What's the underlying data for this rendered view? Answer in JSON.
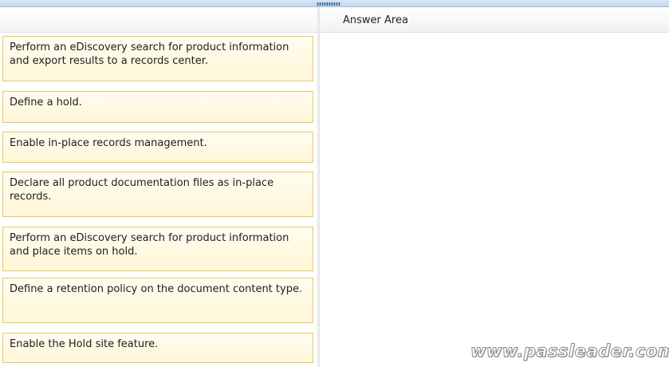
{
  "answer_area": {
    "title": "Answer Area"
  },
  "items": [
    "Perform an eDiscovery search for product information and export results to a records center.",
    "Define a hold.",
    "Enable in-place records management.",
    "Declare all product documentation files as in-place records.",
    "Perform an eDiscovery search for product information and place items on hold.",
    "Define a retention policy on the document content type.",
    "Enable the Hold site feature."
  ],
  "watermark": "www.passleader.com"
}
